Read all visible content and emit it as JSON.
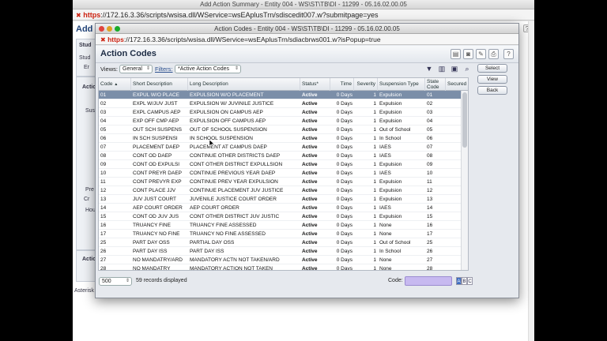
{
  "background_window": {
    "title": "Add Action Summary - Entity 004 - WS\\ST\\TB\\DI - 11299 - 05.16.02.00.05",
    "url_scheme": "https",
    "url_rest": "://172.16.3.36/scripts/wsisa.dll/WService=wsEAplusTrn/sdiscedit007.w?submitpage=yes",
    "heading": "Add A",
    "fragments": [
      "Stud",
      "Stud",
      "Er",
      "Actio",
      "Susp",
      "Pre",
      "Cr",
      "Hou",
      "Actio"
    ],
    "asterisk_note": "Asterisk"
  },
  "popup": {
    "window_title": "Action Codes - Entity 004 - WS\\ST\\TB\\DI - 11299 - 05.16.02.00.05",
    "url_scheme": "https",
    "url_rest": "://172.16.3.36/scripts/wsisa.dll/WService=wsEAplusTrn/sdiacbrws001.w?isPopup=true",
    "title": "Action Codes",
    "toolbar_icons": [
      "report-icon",
      "camera-icon",
      "tools-icon",
      "export-icon",
      "print-icon",
      "help-icon"
    ],
    "help_label": "?",
    "views_label": "Views:",
    "views_value": "General",
    "filters_label": "Filters:",
    "filters_value": "*Active Action Codes",
    "columns": [
      "Code",
      "Short Description",
      "Long Description",
      "Status*",
      "Time",
      "Severity",
      "Suspension Type",
      "State Code",
      "Secured"
    ],
    "sort_indicator": "▲",
    "rows": [
      [
        "01",
        "EXPUL W/O PLACE",
        "EXPULSION W/O PLACEMENT",
        "Active",
        "0 Days",
        "1",
        "Expulsion",
        "01",
        ""
      ],
      [
        "02",
        "EXPL W/JUV JUST",
        "EXPULSION W/ JUVINILE JUSTICE",
        "Active",
        "0 Days",
        "1",
        "Expulsion",
        "02",
        ""
      ],
      [
        "03",
        "EXPL CAMPUS AEP",
        "EXPULSION ON CAMPUS AEP",
        "Active",
        "0 Days",
        "1",
        "Expulsion",
        "03",
        ""
      ],
      [
        "04",
        "EXP OFF CMP AEP",
        "EXPULSION OFF CAMPUS AEP",
        "Active",
        "0 Days",
        "1",
        "Expulsion",
        "04",
        ""
      ],
      [
        "05",
        "OUT SCH SUSPENS",
        "OUT OF SCHOOL SUSPENSION",
        "Active",
        "0 Days",
        "1",
        "Out of School",
        "05",
        ""
      ],
      [
        "06",
        "IN SCH SUSPENSI",
        "IN SCHOOL SUSPENSION",
        "Active",
        "0 Days",
        "1",
        "In School",
        "06",
        ""
      ],
      [
        "07",
        "PLACEMENT DAEP",
        "PLACEMENT AT CAMPUS DAEP",
        "Active",
        "0 Days",
        "1",
        "IAES",
        "07",
        ""
      ],
      [
        "08",
        "CONT OD DAEP",
        "CONTINUE OTHER DISTRICTS DAEP",
        "Active",
        "0 Days",
        "1",
        "IAES",
        "08",
        ""
      ],
      [
        "09",
        "CONT OD EXPULSI",
        "CONT OTHER DISTRICT EXPULLSION",
        "Active",
        "0 Days",
        "1",
        "Expulsion",
        "09",
        ""
      ],
      [
        "10",
        "CONT PREYR DAEP",
        "CONTINUE PREVIOUS YEAR DAEP",
        "Active",
        "0 Days",
        "1",
        "IAES",
        "10",
        ""
      ],
      [
        "11",
        "CONT PREVYR EXP",
        "CONTINUE PREV YEAR EXPULSION",
        "Active",
        "0 Days",
        "1",
        "Expulsion",
        "11",
        ""
      ],
      [
        "12",
        "CONT PLACE JJV",
        "CONTINUE PLACEMENT JUV JUSTICE",
        "Active",
        "0 Days",
        "1",
        "Expulsion",
        "12",
        ""
      ],
      [
        "13",
        "JUV JUST COURT",
        "JUVENILE JUSTICE COURT ORDER",
        "Active",
        "0 Days",
        "1",
        "Expulsion",
        "13",
        ""
      ],
      [
        "14",
        "AEP COURT ORDER",
        "AEP COURT ORDER",
        "Active",
        "0 Days",
        "1",
        "IAES",
        "14",
        ""
      ],
      [
        "15",
        "CONT OD JUV JUS",
        "CONT OTHER DISTRICT JUV JUSTIC",
        "Active",
        "0 Days",
        "1",
        "Expulsion",
        "15",
        ""
      ],
      [
        "16",
        "TRUANCY FINE",
        "TRUANCY FINE ASSESSED",
        "Active",
        "0 Days",
        "1",
        "None",
        "16",
        ""
      ],
      [
        "17",
        "TRUANCY NO FINE",
        "TRUANCY NO FINE ASSESSED",
        "Active",
        "0 Days",
        "1",
        "None",
        "17",
        ""
      ],
      [
        "25",
        "PART DAY OSS",
        "PARTIAL DAY OSS",
        "Active",
        "0 Days",
        "1",
        "Out of School",
        "25",
        ""
      ],
      [
        "26",
        "PART DAY ISS",
        "PART DAY ISS",
        "Active",
        "0 Days",
        "1",
        "In School",
        "26",
        ""
      ],
      [
        "27",
        "NO MANDATRY/ARD",
        "MANDATORY ACTN NOT TAKEN/ARD",
        "Active",
        "0 Days",
        "1",
        "None",
        "27",
        ""
      ],
      [
        "28",
        "NO MANDATRY",
        "MANDATORY ACTION NOT TAKEN",
        "Active",
        "0 Days",
        "1",
        "None",
        "28",
        ""
      ]
    ],
    "selected_row_index": 0,
    "side_buttons": [
      "Select",
      "View",
      "Back"
    ],
    "page_size": "500",
    "records_text": "59 records displayed",
    "code_label": "Code:",
    "code_value": "",
    "abc_buttons": [
      "A",
      "B",
      "C"
    ]
  },
  "colors": {
    "selected_row": "#7b8ea8",
    "code_input": "#c7b9f0",
    "heading": "#1d2c44"
  }
}
